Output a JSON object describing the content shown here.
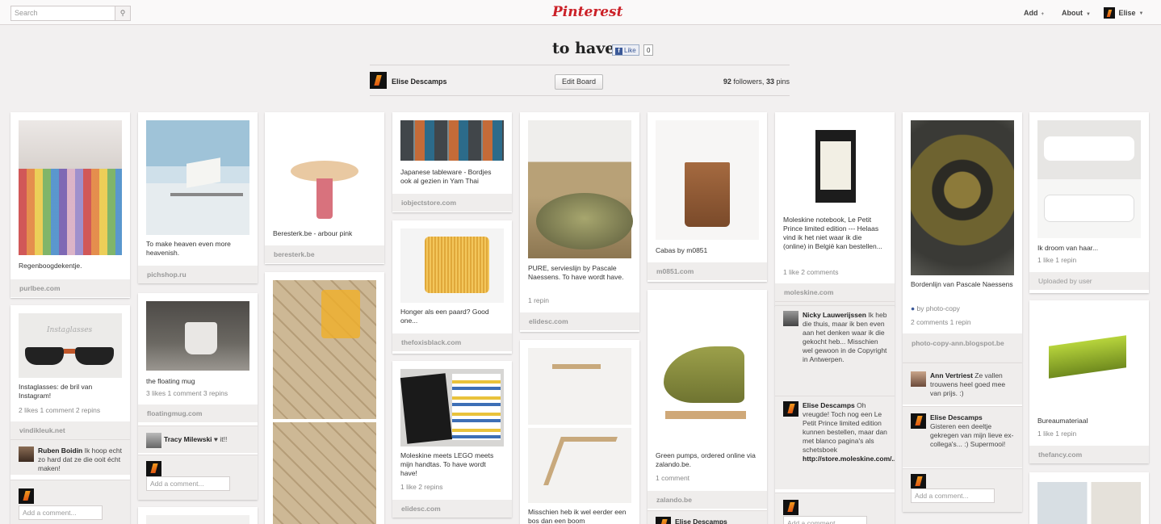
{
  "header": {
    "search_placeholder": "Search",
    "logo": "Pinterest",
    "add": "Add",
    "about": "About",
    "user": "Elise"
  },
  "board": {
    "title": "to have",
    "like": "Like",
    "like_count": "0",
    "owner": "Elise Descamps",
    "edit": "Edit Board",
    "followers": "92",
    "followers_label": "followers,",
    "pins": "33",
    "pins_label": "pins"
  },
  "pins": {
    "p1": {
      "desc": "Regenboogdekentje.",
      "source": "purlbee.com"
    },
    "p2": {
      "desc": "Instaglasses: de bril van Instagram!",
      "stats": "2 likes  1 comment  2 repins",
      "source": "vindikleuk.net",
      "img_text": "Instaglasses",
      "comment": {
        "author": "Ruben Boidin",
        "text": "Ik hoop echt zo hard dat ze die ooit écht maken!"
      },
      "add_comment": "Add a comment..."
    },
    "p3": {
      "desc": "To make heaven even more heavenish.",
      "source": "pichshop.ru"
    },
    "p4": {
      "desc": "the floating mug",
      "stats": "3 likes  1 comment  3 repins",
      "source": "floatingmug.com",
      "comment": {
        "author": "Tracy Milewski",
        "text": "♥ it!!"
      },
      "add_comment": "Add a comment..."
    },
    "p5": {
      "desc": "Beresterk.be - arbour pink",
      "source": "beresterk.be"
    },
    "p7": {
      "desc": "Japanese tableware - Bordjes ook al gezien in Yam Thai",
      "source": "iobjectstore.com"
    },
    "p8": {
      "desc": "Honger als een paard? Good one...",
      "source": "thefoxisblack.com"
    },
    "p9": {
      "desc": "Moleskine meets LEGO meets mijn handtas. To have wordt have!",
      "stats": "1 like  2 repins",
      "source": "elidesc.com"
    },
    "p10": {
      "desc": "PURE, servieslijn by Pascale Naessens. To have wordt have.",
      "stats": "1 repin",
      "source": "elidesc.com"
    },
    "p11": {
      "desc": "Misschien heb ik wel eerder een bos dan een boom"
    },
    "p12": {
      "desc": "Cabas by m0851",
      "source": "m0851.com"
    },
    "p13": {
      "desc": "Green pumps, ordered online via zalando.be.",
      "stats": "1 comment",
      "source": "zalando.be",
      "comment_author": "Elise Descamps"
    },
    "p14": {
      "desc": "Moleskine notebook, Le Petit Prince limited edition --- Helaas vind ik het niet waar ik die (online) in België kan bestellen...",
      "stats": "1 like  2 comments",
      "source": "moleskine.com",
      "comment1": {
        "author": "Nicky Lauwerijssen",
        "text": "Ik heb die thuis, maar ik ben even aan het denken waar ik die gekocht heb... Misschien wel gewoon in de Copyright in Antwerpen."
      },
      "comment2": {
        "author": "Elise Descamps",
        "text": "Oh vreugde! Toch nog een Le Petit Prince limited edition kunnen bestellen, maar dan met blanco pagina's als schetsboek",
        "link": "http://store.moleskine.com/..."
      },
      "add_comment": "Add a comment..."
    },
    "p15": {
      "desc": "Bordenlijn van Pascale Naessens",
      "via": "by",
      "via_user": "photo-copy",
      "stats": "2 comments  1 repin",
      "source": "photo-copy-ann.blogspot.be",
      "comment1": {
        "author": "Ann Vertriest",
        "text": "Ze vallen trouwens heel goed mee van prijs. :)"
      },
      "comment2": {
        "author": "Elise Descamps",
        "text": "Gisteren een deeltje gekregen van mijn lieve ex-collega's... :) Supermooi!"
      },
      "add_comment": "Add a comment..."
    },
    "p16": {
      "desc": "Ik droom van haar...",
      "stats": "1 like  1 repin",
      "source": "Uploaded by user"
    },
    "p17": {
      "desc": "Bureaumateriaal",
      "stats": "1 like  1 repin",
      "source": "thefancy.com"
    }
  }
}
